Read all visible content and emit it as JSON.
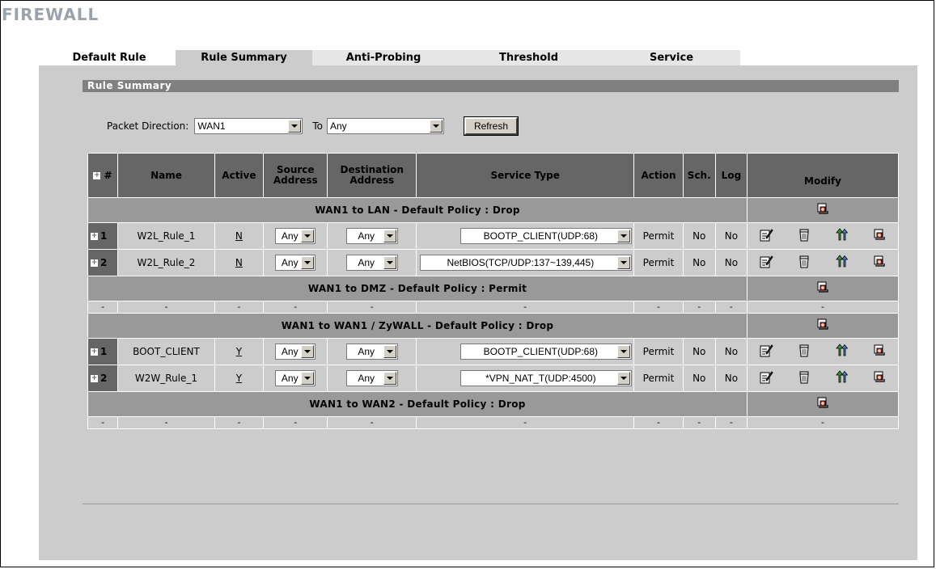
{
  "page": {
    "title": "FIREWALL"
  },
  "tabs": [
    {
      "label": "Default Rule"
    },
    {
      "label": "Rule Summary"
    },
    {
      "label": "Anti-Probing"
    },
    {
      "label": "Threshold"
    },
    {
      "label": "Service"
    }
  ],
  "section": {
    "title": "Rule Summary"
  },
  "direction": {
    "label": "Packet Direction:",
    "from": "WAN1",
    "to_label": "To",
    "to": "Any",
    "refresh_label": "Refresh"
  },
  "table": {
    "headers": {
      "num": "#",
      "name": "Name",
      "active": "Active",
      "source": "Source Address",
      "destination": "Destination Address",
      "service": "Service Type",
      "action": "Action",
      "sch": "Sch.",
      "log": "Log",
      "modify": "Modify"
    },
    "groups": [
      {
        "title": "WAN1 to LAN - Default Policy : Drop",
        "rules": [
          {
            "num": "1",
            "name": "W2L_Rule_1",
            "active": "N",
            "source": "Any",
            "destination": "Any",
            "service": "BOOTP_CLIENT(UDP:68)",
            "action": "Permit",
            "sch": "No",
            "log": "No"
          },
          {
            "num": "2",
            "name": "W2L_Rule_2",
            "active": "N",
            "source": "Any",
            "destination": "Any",
            "service": "NetBIOS(TCP/UDP:137~139,445)",
            "action": "Permit",
            "sch": "No",
            "log": "No"
          }
        ]
      },
      {
        "title": "WAN1 to DMZ - Default Policy : Permit",
        "rules": []
      },
      {
        "title": "WAN1 to WAN1 / ZyWALL - Default Policy : Drop",
        "rules": [
          {
            "num": "1",
            "name": "BOOT_CLIENT",
            "active": "Y",
            "source": "Any",
            "destination": "Any",
            "service": "BOOTP_CLIENT(UDP:68)",
            "action": "Permit",
            "sch": "No",
            "log": "No"
          },
          {
            "num": "2",
            "name": "W2W_Rule_1",
            "active": "Y",
            "source": "Any",
            "destination": "Any",
            "service": "*VPN_NAT_T(UDP:4500)",
            "action": "Permit",
            "sch": "No",
            "log": "No"
          }
        ]
      },
      {
        "title": "WAN1 to WAN2 - Default Policy : Drop",
        "rules": []
      }
    ],
    "empty_mark": "-"
  },
  "icons": {
    "expand": "+",
    "modify_icons": [
      "edit-icon",
      "delete-icon",
      "move-icon",
      "insert-icon"
    ],
    "group_icon": "insert-icon"
  },
  "colors": {
    "header_bg": "#666666",
    "group_bg": "#999999",
    "content_bg": "#cccccc",
    "title_color": "#9aa3ab"
  }
}
